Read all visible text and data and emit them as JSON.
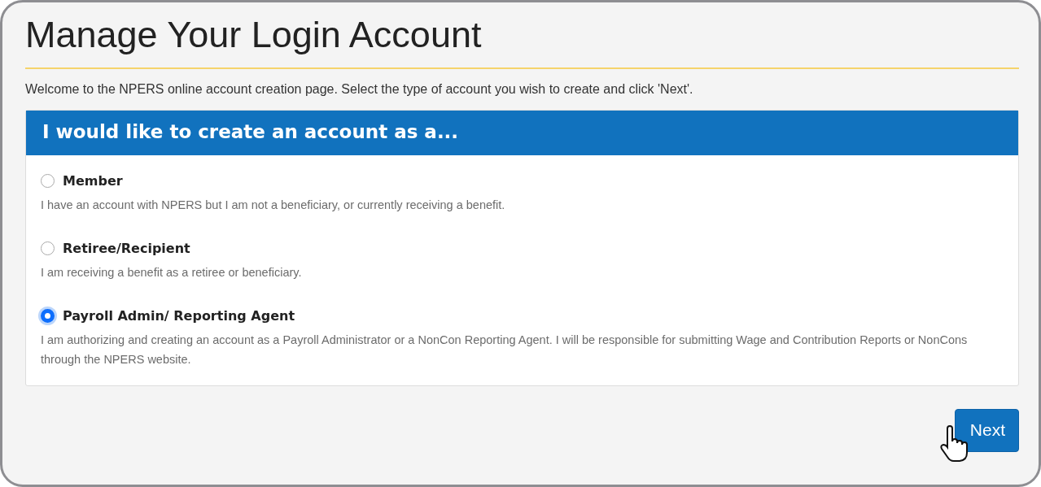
{
  "page": {
    "title": "Manage Your Login Account",
    "intro": "Welcome to the NPERS online account creation page. Select the type of account you wish to create and click 'Next'."
  },
  "card": {
    "heading": "I would like to create an account as a...",
    "options": [
      {
        "label": "Member",
        "description": "I have an account with NPERS but I am not a beneficiary, or currently receiving a benefit.",
        "selected": false
      },
      {
        "label": "Retiree/Recipient",
        "description": "I am receiving a benefit as a retiree or beneficiary.",
        "selected": false
      },
      {
        "label": "Payroll Admin/ Reporting Agent",
        "description": "I am authorizing and creating an account as a Payroll Administrator or a NonCon Reporting Agent. I will be responsible for submitting Wage and Contribution Reports or NonCons through the NPERS website.",
        "selected": true
      }
    ]
  },
  "buttons": [
    {
      "label": "Next"
    }
  ]
}
